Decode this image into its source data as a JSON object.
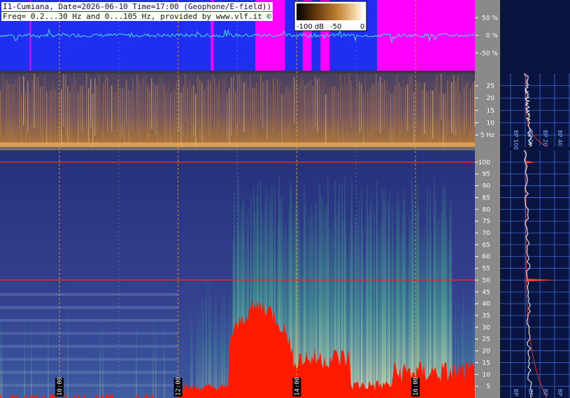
{
  "header": {
    "line1": "I1-Cumiana, Date=2026-06-10 Time=17:00 (Geophone/E-field))",
    "line2": "Freq= 0.2...30 Hz and 0...105 Hz, provided by www.vlf.it ©"
  },
  "colorbar": {
    "ticks": [
      "-100 dB",
      "-50",
      "0"
    ],
    "stops": [
      "#000000",
      "#6a3a10",
      "#c08030",
      "#f0d0a0",
      "#ffffff"
    ]
  },
  "colors": {
    "panel_bg": "#0a1440",
    "amplitude_blue": "#1f2ef0",
    "saturation_magenta": "#ff00ff",
    "trace_cyan": "#40e0e0",
    "mains_line": "#e03020",
    "spectrum_low": "#2c3a8c",
    "spectrum_mid": "#3fa88a",
    "spectrum_high": "#f2efb0",
    "spectrum_sat": "#ff1a00"
  },
  "chart_data": [
    {
      "type": "line",
      "name": "amplitude",
      "yticks": [
        "50 %",
        "0 %",
        "-50 %"
      ],
      "y_values": [
        50,
        0,
        -50
      ],
      "ylim": [
        -100,
        100
      ],
      "saturation_intervals_hours": [
        [
          9.5,
          9.52
        ],
        [
          12.55,
          12.6
        ],
        [
          13.3,
          13.8
        ],
        [
          14.1,
          14.25
        ],
        [
          14.4,
          14.55
        ],
        [
          15.35,
          17.0
        ]
      ]
    },
    {
      "type": "heatmap",
      "name": "low-frequency spectrogram",
      "ylabel_suffix": "Hz",
      "yticks": [
        "25",
        "20",
        "15",
        "10",
        "5 Hz"
      ],
      "y_values": [
        25,
        20,
        15,
        10,
        5
      ],
      "ylim": [
        0.2,
        30
      ]
    },
    {
      "type": "heatmap",
      "name": "spectrogram 0-105 Hz",
      "xlim_hours": [
        9.0,
        17.0
      ],
      "xticks": [
        "10:00",
        "12:00",
        "14:00",
        "16:00"
      ],
      "x_hours": [
        10,
        12,
        14,
        16
      ],
      "yticks": [
        "100",
        "95",
        "90",
        "85",
        "80",
        "75",
        "70",
        "65",
        "60",
        "55",
        "50",
        "45",
        "40",
        "35",
        "30",
        "25",
        "20",
        "15",
        "10",
        "5"
      ],
      "y_values": [
        100,
        95,
        90,
        85,
        80,
        75,
        70,
        65,
        60,
        55,
        50,
        45,
        40,
        35,
        30,
        25,
        20,
        15,
        10,
        5
      ],
      "ylim": [
        0,
        105
      ],
      "horizontal_lines_hz": [
        50,
        100
      ]
    },
    {
      "type": "line",
      "name": "spectrum profile",
      "xticks": [
        "BP 100",
        "BP 0",
        "BP 20",
        "BP 40",
        "BP 80"
      ],
      "top_xticks": [
        "BP 100",
        "BP 0",
        "BP 20",
        "BP 40",
        "BP 80"
      ],
      "peaks_hz": [
        50,
        100
      ]
    }
  ]
}
